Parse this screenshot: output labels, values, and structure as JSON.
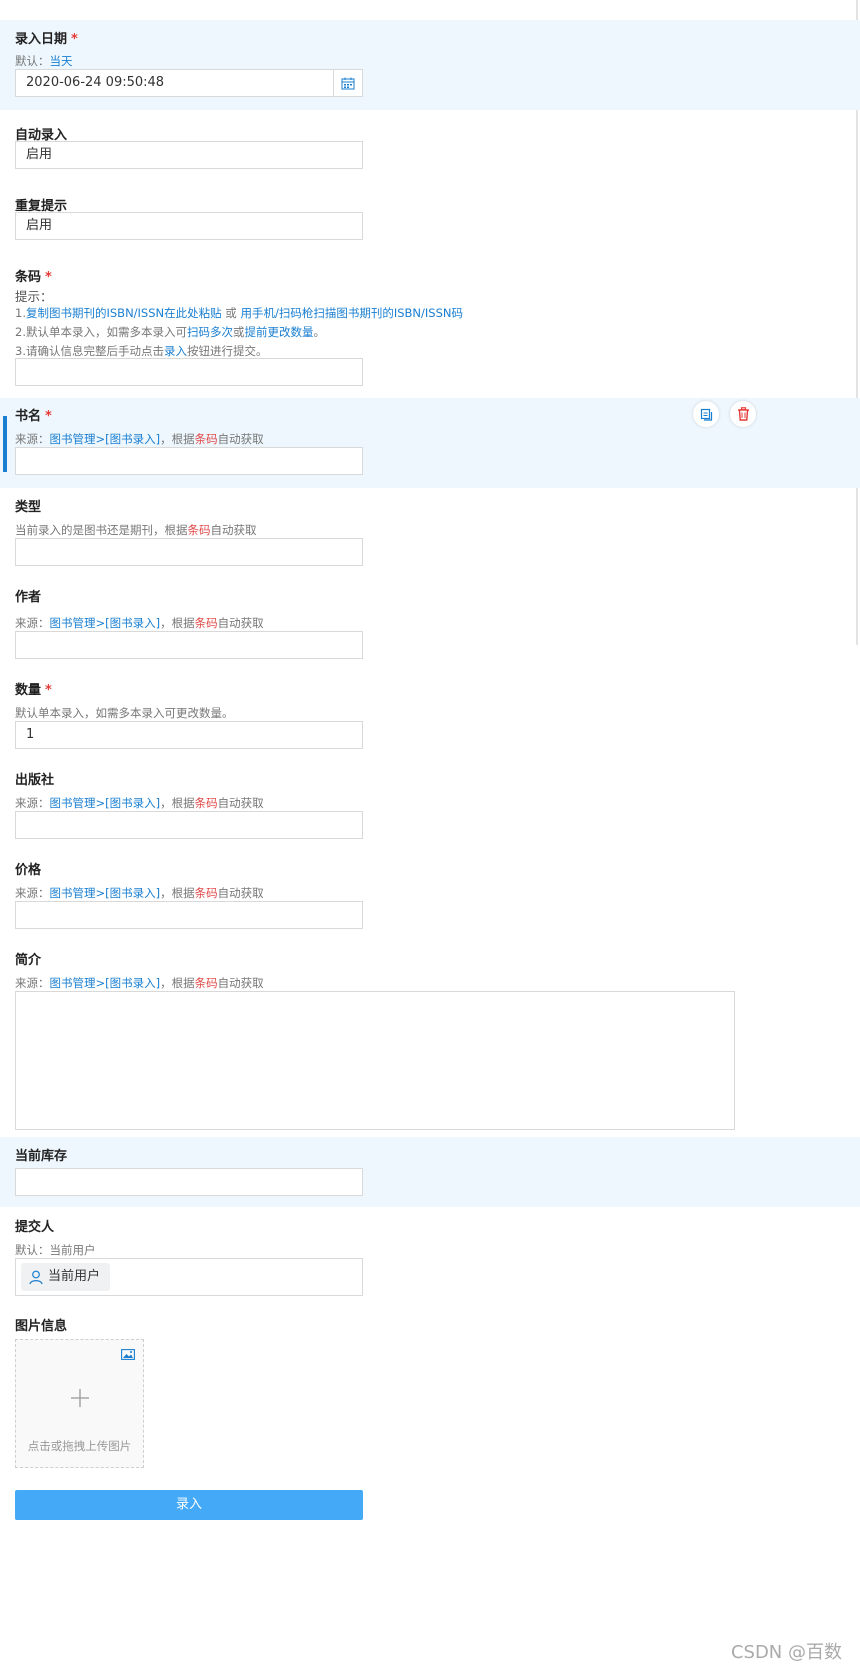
{
  "entry_date": {
    "label": "录入日期",
    "required": "*",
    "hint_prefix": "默认：",
    "hint_link": "当天",
    "value": "2020-06-24 09:50:48"
  },
  "auto_entry": {
    "label": "自动录入",
    "value": "启用"
  },
  "repeat_prompt": {
    "label": "重复提示",
    "value": "启用"
  },
  "barcode": {
    "label": "条码",
    "required": "*",
    "hint_title": "提示：",
    "line1_prefix": "1.",
    "line1_link1": "复制图书期刊的ISBN/ISSN在此处粘贴",
    "line1_mid": " 或 ",
    "line1_link2": "用手机/扫码枪扫描图书期刊的ISBN/ISSN码",
    "line2_prefix": "2.默认单本录入，如需多本录入可",
    "line2_link1": "扫码多次",
    "line2_mid": "或",
    "line2_link2": "提前更改数量",
    "line2_end": "。",
    "line3_prefix": "3.请确认信息完整后手动点击",
    "line3_link": "录入",
    "line3_end": "按钮进行提交。"
  },
  "source_hint": {
    "prefix": "来源：",
    "link": "图书管理>[图书录入]",
    "mid": "，根据",
    "red": "条码",
    "end": "自动获取"
  },
  "book_name": {
    "label": "书名",
    "required": "*"
  },
  "type": {
    "label": "类型",
    "hint_prefix": "当前录入的是图书还是期刊，根据",
    "hint_red": "条码",
    "hint_end": "自动获取"
  },
  "author": {
    "label": "作者"
  },
  "quantity": {
    "label": "数量",
    "required": "*",
    "hint": "默认单本录入，如需多本录入可更改数量。",
    "value": "1"
  },
  "publisher": {
    "label": "出版社"
  },
  "price": {
    "label": "价格"
  },
  "intro": {
    "label": "简介"
  },
  "stock": {
    "label": "当前库存"
  },
  "submitter": {
    "label": "提交人",
    "hint": "默认：当前用户",
    "user": "当前用户"
  },
  "image": {
    "label": "图片信息",
    "upload_text": "点击或拖拽上传图片"
  },
  "submit_label": "录入",
  "watermark": "CSDN @百数",
  "colors": {
    "accent": "#1a7fd1",
    "button": "#44aaf8",
    "required": "#e53935",
    "highlight": "#eef7fd"
  }
}
